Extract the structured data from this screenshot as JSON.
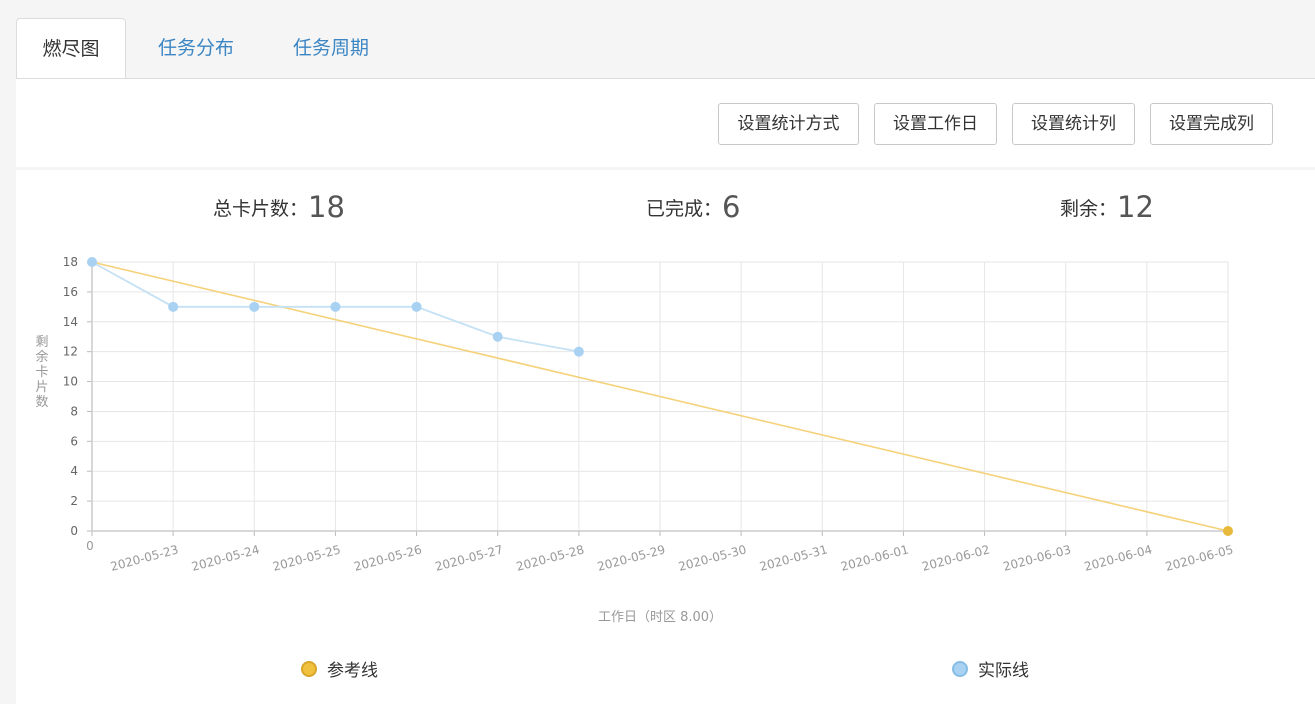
{
  "tabs": [
    {
      "label": "燃尽图",
      "active": true
    },
    {
      "label": "任务分布",
      "active": false
    },
    {
      "label": "任务周期",
      "active": false
    }
  ],
  "toolbar": {
    "btn_stat_mode": "设置统计方式",
    "btn_workdays": "设置工作日",
    "btn_stat_column": "设置统计列",
    "btn_done_column": "设置完成列"
  },
  "stats": {
    "total_label": "总卡片数：",
    "total_value": "18",
    "done_label": "已完成：",
    "done_value": "6",
    "remaining_label": "剩余：",
    "remaining_value": "12"
  },
  "chart_data": {
    "type": "line",
    "x": [
      "0",
      "2020-05-23",
      "2020-05-24",
      "2020-05-25",
      "2020-05-26",
      "2020-05-27",
      "2020-05-28",
      "2020-05-29",
      "2020-05-30",
      "2020-05-31",
      "2020-06-01",
      "2020-06-02",
      "2020-06-03",
      "2020-06-04",
      "2020-06-05"
    ],
    "xlabel": "工作日（时区 8.00）",
    "ylabel": "剩余卡片数",
    "ylim": [
      0,
      18
    ],
    "yticks": [
      0,
      2,
      4,
      6,
      8,
      10,
      12,
      14,
      16,
      18
    ],
    "grid": true,
    "legend_position": "bottom",
    "series": [
      {
        "name": "参考线",
        "color": "#f5d27a",
        "marker_color": "#e8b93a",
        "points": [
          [
            0,
            18
          ],
          [
            14,
            0
          ]
        ],
        "marker_at": [
          14
        ]
      },
      {
        "name": "实际线",
        "color": "#c5e1f5",
        "marker_color": "#a9d1f2",
        "points": [
          [
            0,
            18
          ],
          [
            1,
            15
          ],
          [
            2,
            15
          ],
          [
            3,
            15
          ],
          [
            4,
            15
          ],
          [
            5,
            13
          ],
          [
            6,
            12
          ]
        ],
        "marker_at": [
          0,
          1,
          2,
          3,
          4,
          5,
          6
        ]
      }
    ]
  },
  "legend": [
    {
      "label": "参考线",
      "fill": "#efc13f",
      "border": "#d9a52a"
    },
    {
      "label": "实际线",
      "fill": "#a9d1f2",
      "border": "#86bde6"
    }
  ]
}
